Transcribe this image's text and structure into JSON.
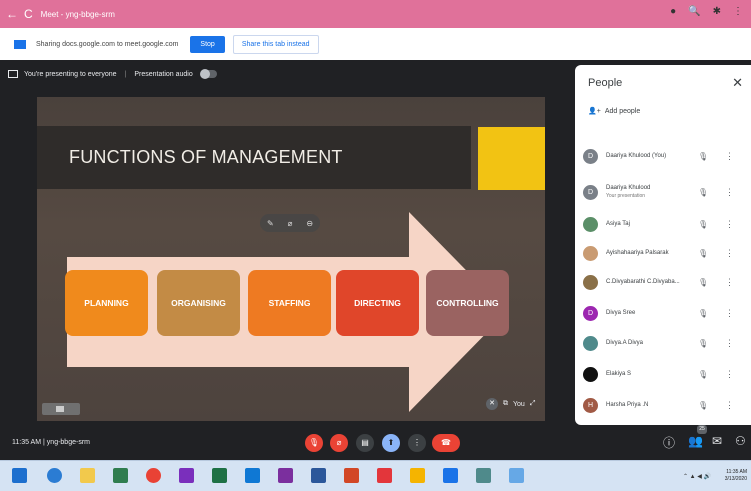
{
  "browser": {
    "tab_title": "Meet - yng-bbge-srm"
  },
  "share": {
    "text": "Sharing docs.google.com to meet.google.com",
    "stop_label": "Stop",
    "share_tab_label": "Share this tab instead"
  },
  "presenting": {
    "text": "You're presenting to everyone",
    "audio_label": "Presentation audio"
  },
  "slide": {
    "title": "FUNCTIONS OF MANAGEMENT",
    "steps": [
      "PLANNING",
      "ORGANISING",
      "STAFFING",
      "DIRECTING",
      "CONTROLLING"
    ],
    "step_colors": [
      "#f08a1c",
      "#c38b45",
      "#ee7a22",
      "#e0462a",
      "#9a6361"
    ]
  },
  "self_tile": {
    "label": "You"
  },
  "people": {
    "title": "People",
    "add_label": "Add people",
    "participants": [
      {
        "initial": "D",
        "name": "Daariya Khulood (You)",
        "sub": "",
        "color": "#7a8088"
      },
      {
        "initial": "D",
        "name": "Daariya Khulood",
        "sub": "Your presentation",
        "color": "#7a8088"
      },
      {
        "initial": "",
        "name": "Asiya Taj",
        "sub": "",
        "color": "#5b8f68"
      },
      {
        "initial": "",
        "name": "Ayishahaariya Palsarak",
        "sub": "",
        "color": "#c99b72"
      },
      {
        "initial": "",
        "name": "C.Divyabarathi C.Divyaba...",
        "sub": "",
        "color": "#8a7048"
      },
      {
        "initial": "D",
        "name": "Divya Sree",
        "sub": "",
        "color": "#9c27b0"
      },
      {
        "initial": "",
        "name": "Divya.A Divya",
        "sub": "",
        "color": "#4f8a8b"
      },
      {
        "initial": "",
        "name": "Elakiya S",
        "sub": "",
        "color": "#111111"
      },
      {
        "initial": "H",
        "name": "Harsha Priya .N",
        "sub": "",
        "color": "#a15a45"
      }
    ]
  },
  "bottom": {
    "time": "11:35 AM",
    "separator": "|",
    "meeting_code": "yng-bbge-srm",
    "participant_count": "25"
  },
  "taskbar": {
    "clock_time": "11:35 AM",
    "clock_date": "3/13/2020"
  },
  "colors": {
    "titlebar": "#e0719a",
    "accent": "#1a73e8",
    "end_call": "#ea4335",
    "slide_yellow": "#f2c313"
  }
}
